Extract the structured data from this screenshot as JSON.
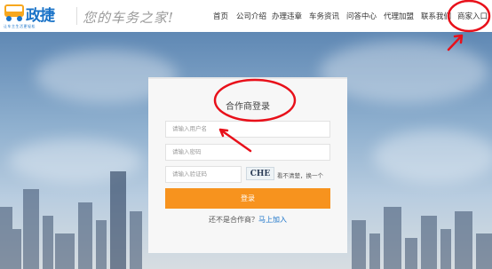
{
  "brand": {
    "name": "政捷",
    "tagline": "让车主生活更轻松",
    "slogan": "您的车务之家!"
  },
  "nav": {
    "items": [
      {
        "label": "首页"
      },
      {
        "label": "公司介绍"
      },
      {
        "label": "办理违章"
      },
      {
        "label": "车务资讯"
      },
      {
        "label": "问答中心"
      },
      {
        "label": "代理加盟"
      },
      {
        "label": "联系我们"
      },
      {
        "label": "商家入口"
      }
    ]
  },
  "login": {
    "title": "合作商登录",
    "username_placeholder": "请输入用户名",
    "password_placeholder": "请输入密码",
    "captcha_placeholder": "请输入验证码",
    "captcha_text": "CHE",
    "captcha_refresh": "看不清楚，换一个",
    "submit_label": "登录",
    "join_prompt": "还不是合作商？",
    "join_link": "马上加入"
  },
  "colors": {
    "brand_blue": "#1a73c8",
    "button_orange": "#f7931e",
    "annotation_red": "#e8101a"
  }
}
